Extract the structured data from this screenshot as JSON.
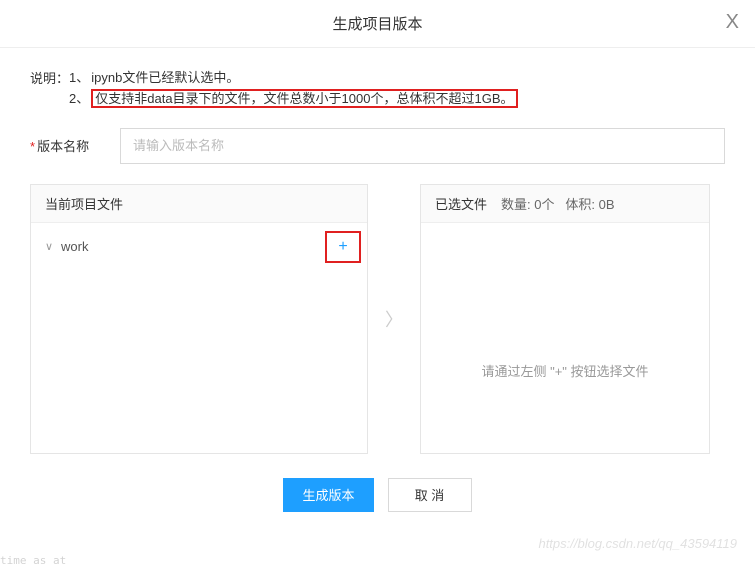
{
  "dialog": {
    "title": "生成项目版本",
    "close_glyph": "X"
  },
  "description": {
    "label": "说明：",
    "line1_num": "1、",
    "line1_text": "ipynb文件已经默认选中。",
    "line2_num": "2、",
    "line2_text": "仅支持非data目录下的文件，文件总数小于1000个，总体积不超过1GB。"
  },
  "form": {
    "version_name_label": "版本名称",
    "version_name_placeholder": "请输入版本名称"
  },
  "panels": {
    "left_title": "当前项目文件",
    "right_title": "已选文件",
    "right_count_label": "数量:",
    "right_count_value": "0个",
    "right_size_label": "体积:",
    "right_size_value": "0B",
    "tree_root": "work",
    "add_glyph": "+",
    "chevron_glyph": "∨",
    "arrow_glyph": "〉",
    "empty_hint": "请通过左侧 \"+\" 按钮选择文件"
  },
  "footer": {
    "submit_label": "生成版本",
    "cancel_label": "取 消"
  },
  "watermark": "https://blog.csdn.net/qq_43594119",
  "bg_code": "time as at"
}
